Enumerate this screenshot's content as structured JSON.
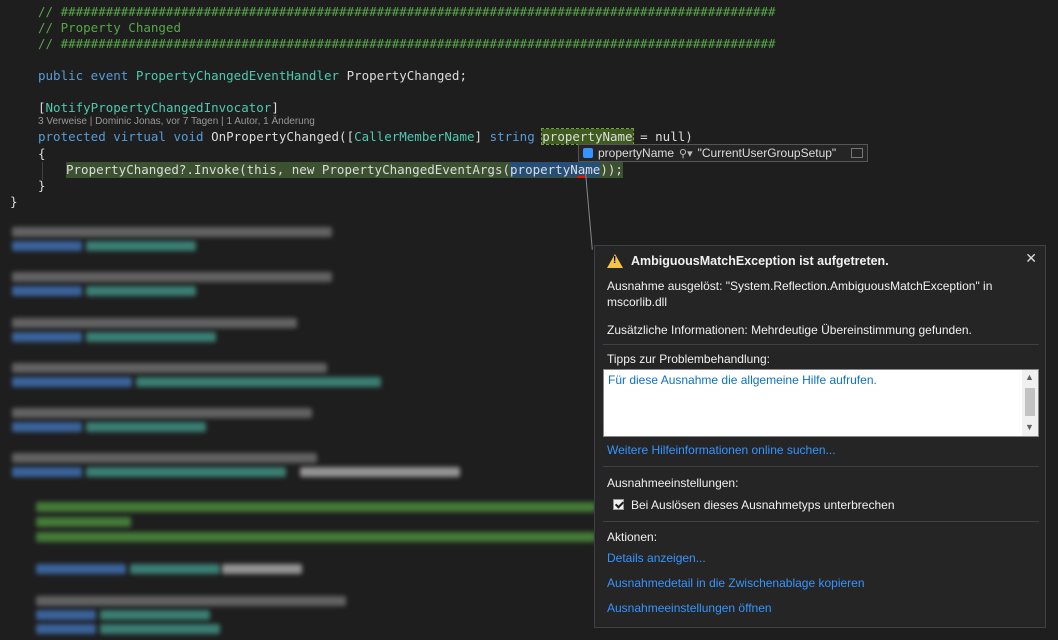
{
  "code": {
    "hash_line": "// ###############################################################################################",
    "region_comment": "// Property Changed",
    "event_kw": "public event",
    "event_type": "PropertyChangedEventHandler",
    "event_name": " PropertyChanged;",
    "attribute_open": "[",
    "attribute_name": "NotifyPropertyChangedInvocator",
    "attribute_close": "]",
    "codelens": "3 Verweise | Dominic Jonas, vor 7 Tagen | 1 Autor, 1 Änderung",
    "sig_kw": "protected virtual void",
    "sig_name": " OnPropertyChanged([",
    "sig_attr": "CallerMemberName",
    "sig_mid": "] ",
    "sig_string": "string",
    "sig_param": "propertyName",
    "sig_end": " = null)",
    "open_brace": "{",
    "body_prefix": "PropertyChanged?.Invoke(this, new PropertyChangedEventArgs(",
    "body_param": "propertyName",
    "body_suffix": "));",
    "close_brace": "}",
    "outer_close": "}"
  },
  "datatip": {
    "name": "propertyName",
    "search_icon": "search-icon",
    "value": "\"CurrentUserGroupSetup\""
  },
  "exception": {
    "title": "AmbiguousMatchException ist aufgetreten.",
    "thrown_line1": "Ausnahme ausgelöst: \"System.Reflection.AmbiguousMatchException\" in",
    "thrown_line2": "mscorlib.dll",
    "additional": "Zusätzliche Informationen: Mehrdeutige Übereinstimmung gefunden.",
    "tips_heading": "Tipps zur Problembehandlung:",
    "tips_link": "Für diese Ausnahme die allgemeine Hilfe aufrufen.",
    "more_help": "Weitere Hilfeinformationen online suchen...",
    "settings_heading": "Ausnahmeeinstellungen:",
    "break_label": "Bei Auslösen dieses Ausnahmetyps unterbrechen",
    "break_checked": true,
    "actions_heading": "Aktionen:",
    "action_details": "Details anzeigen...",
    "action_copy": "Ausnahmedetail in die Zwischenablage kopieren",
    "action_settings": "Ausnahmeeinstellungen öffnen",
    "close_label": "✕"
  },
  "colors": {
    "background": "#1e1e1e",
    "comment": "#57a64a",
    "keyword": "#569cd6",
    "type": "#4ec9b0",
    "link": "#3794ff",
    "warning": "#f6c343"
  }
}
